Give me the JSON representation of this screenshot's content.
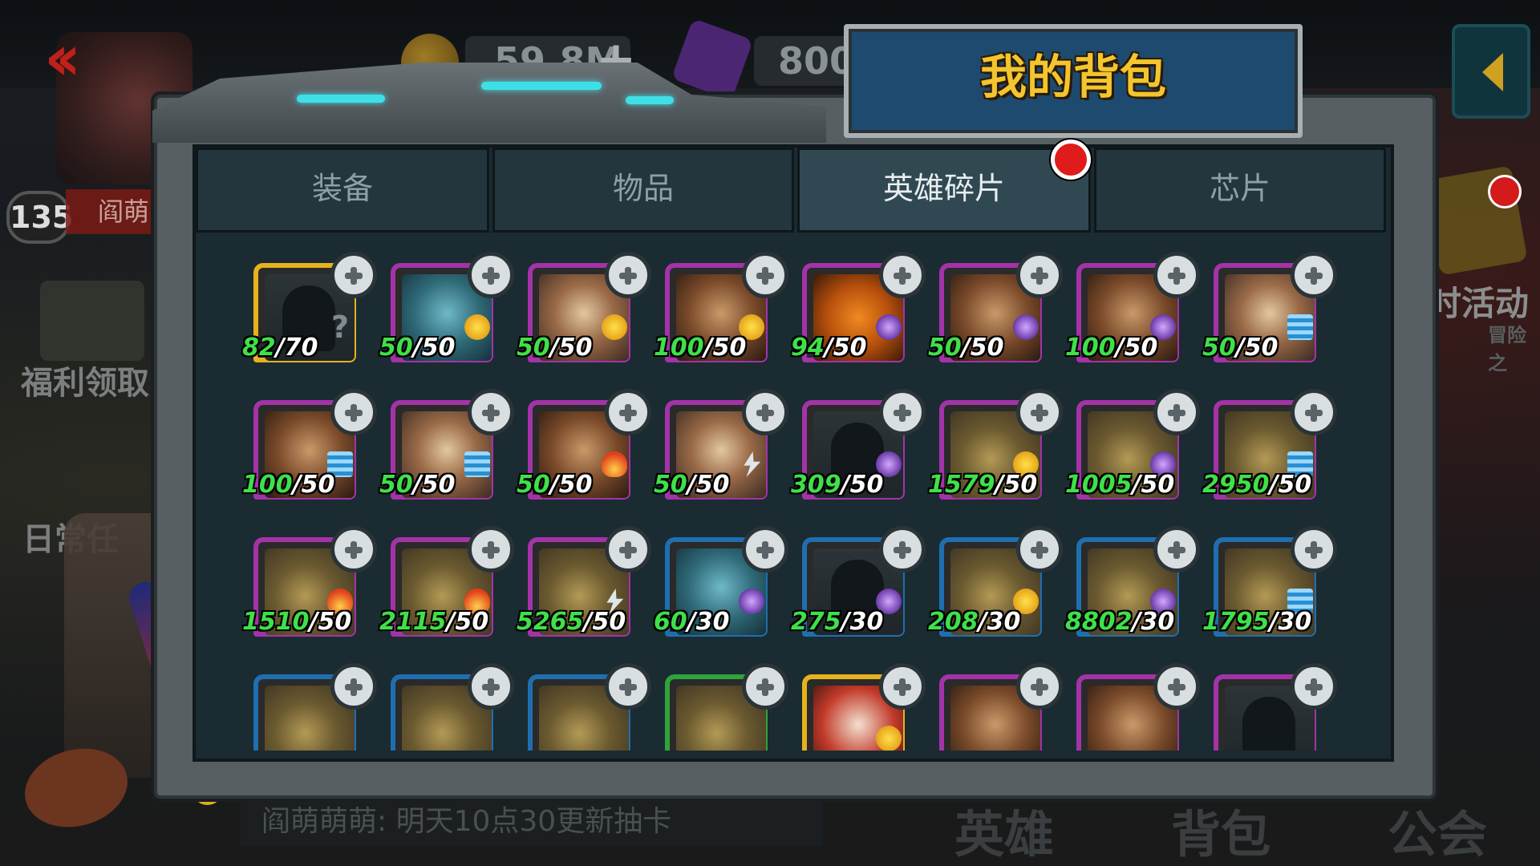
{
  "title": "我的背包",
  "resources": {
    "coins": "59.8M",
    "gems": "800"
  },
  "player": {
    "level": "135",
    "name": "阎萌"
  },
  "tabs": [
    {
      "label": "装备",
      "active": false
    },
    {
      "label": "物品",
      "active": false
    },
    {
      "label": "英雄碎片",
      "active": true,
      "has_notification": true
    },
    {
      "label": "芯片",
      "active": false
    }
  ],
  "side_menu": {
    "welfare": "福利领取",
    "daily": "日常任",
    "event": "时活动",
    "event_sub": "冒险之"
  },
  "chat": {
    "message": "阎萌萌萌: 明天10点30更新抽卡"
  },
  "bottom_tabs": [
    "英雄",
    "背包",
    "公会"
  ],
  "colors": {
    "green_count": "#3fe04a",
    "title_gold": "#f3c52e",
    "banner_blue": "#1e4a70"
  },
  "shards": [
    {
      "have": "82",
      "need": "70",
      "rarity": "gold",
      "portrait": "unknown",
      "element": "question"
    },
    {
      "have": "50",
      "need": "50",
      "rarity": "purple",
      "portrait": "blue-hero",
      "element": "sun"
    },
    {
      "have": "50",
      "need": "50",
      "rarity": "purple",
      "portrait": "hero-a",
      "element": "sun"
    },
    {
      "have": "100",
      "need": "50",
      "rarity": "purple",
      "portrait": "hero-b",
      "element": "sun"
    },
    {
      "have": "94",
      "need": "50",
      "rarity": "purple",
      "portrait": "pumpkin",
      "element": "void"
    },
    {
      "have": "50",
      "need": "50",
      "rarity": "purple",
      "portrait": "hero-b",
      "element": "void"
    },
    {
      "have": "100",
      "need": "50",
      "rarity": "purple",
      "portrait": "hero-b",
      "element": "void"
    },
    {
      "have": "50",
      "need": "50",
      "rarity": "purple",
      "portrait": "hero-a",
      "element": "water"
    },
    {
      "have": "100",
      "need": "50",
      "rarity": "purple",
      "portrait": "hero-b",
      "element": "water"
    },
    {
      "have": "50",
      "need": "50",
      "rarity": "purple",
      "portrait": "hero-a",
      "element": "water"
    },
    {
      "have": "50",
      "need": "50",
      "rarity": "purple",
      "portrait": "hero-b",
      "element": "fire"
    },
    {
      "have": "50",
      "need": "50",
      "rarity": "purple",
      "portrait": "hero-a",
      "element": "bolt"
    },
    {
      "have": "309",
      "need": "50",
      "rarity": "purple",
      "portrait": "unknown",
      "element": "void"
    },
    {
      "have": "1579",
      "need": "50",
      "rarity": "purple",
      "portrait": "robot",
      "element": "sun"
    },
    {
      "have": "1005",
      "need": "50",
      "rarity": "purple",
      "portrait": "robot",
      "element": "void"
    },
    {
      "have": "2950",
      "need": "50",
      "rarity": "purple",
      "portrait": "robot",
      "element": "water"
    },
    {
      "have": "1510",
      "need": "50",
      "rarity": "purple",
      "portrait": "robot",
      "element": "fire"
    },
    {
      "have": "2115",
      "need": "50",
      "rarity": "purple",
      "portrait": "robot",
      "element": "fire"
    },
    {
      "have": "5265",
      "need": "50",
      "rarity": "purple",
      "portrait": "robot",
      "element": "bolt"
    },
    {
      "have": "60",
      "need": "30",
      "rarity": "blue",
      "portrait": "blue-hero",
      "element": "void"
    },
    {
      "have": "275",
      "need": "30",
      "rarity": "blue",
      "portrait": "unknown",
      "element": "void"
    },
    {
      "have": "208",
      "need": "30",
      "rarity": "blue",
      "portrait": "robot",
      "element": "sun"
    },
    {
      "have": "8802",
      "need": "30",
      "rarity": "blue",
      "portrait": "robot",
      "element": "void"
    },
    {
      "have": "1795",
      "need": "30",
      "rarity": "blue",
      "portrait": "robot",
      "element": "water"
    },
    {
      "have": "",
      "need": "",
      "rarity": "blue",
      "portrait": "robot",
      "element": ""
    },
    {
      "have": "",
      "need": "",
      "rarity": "blue",
      "portrait": "robot",
      "element": ""
    },
    {
      "have": "",
      "need": "",
      "rarity": "blue",
      "portrait": "robot",
      "element": ""
    },
    {
      "have": "",
      "need": "",
      "rarity": "green",
      "portrait": "robot",
      "element": ""
    },
    {
      "have": "",
      "need": "",
      "rarity": "gold",
      "portrait": "clown",
      "element": "sun"
    },
    {
      "have": "",
      "need": "",
      "rarity": "purple",
      "portrait": "hero-b",
      "element": ""
    },
    {
      "have": "",
      "need": "",
      "rarity": "purple",
      "portrait": "hero-b",
      "element": ""
    },
    {
      "have": "",
      "need": "",
      "rarity": "purple",
      "portrait": "unknown",
      "element": ""
    }
  ]
}
